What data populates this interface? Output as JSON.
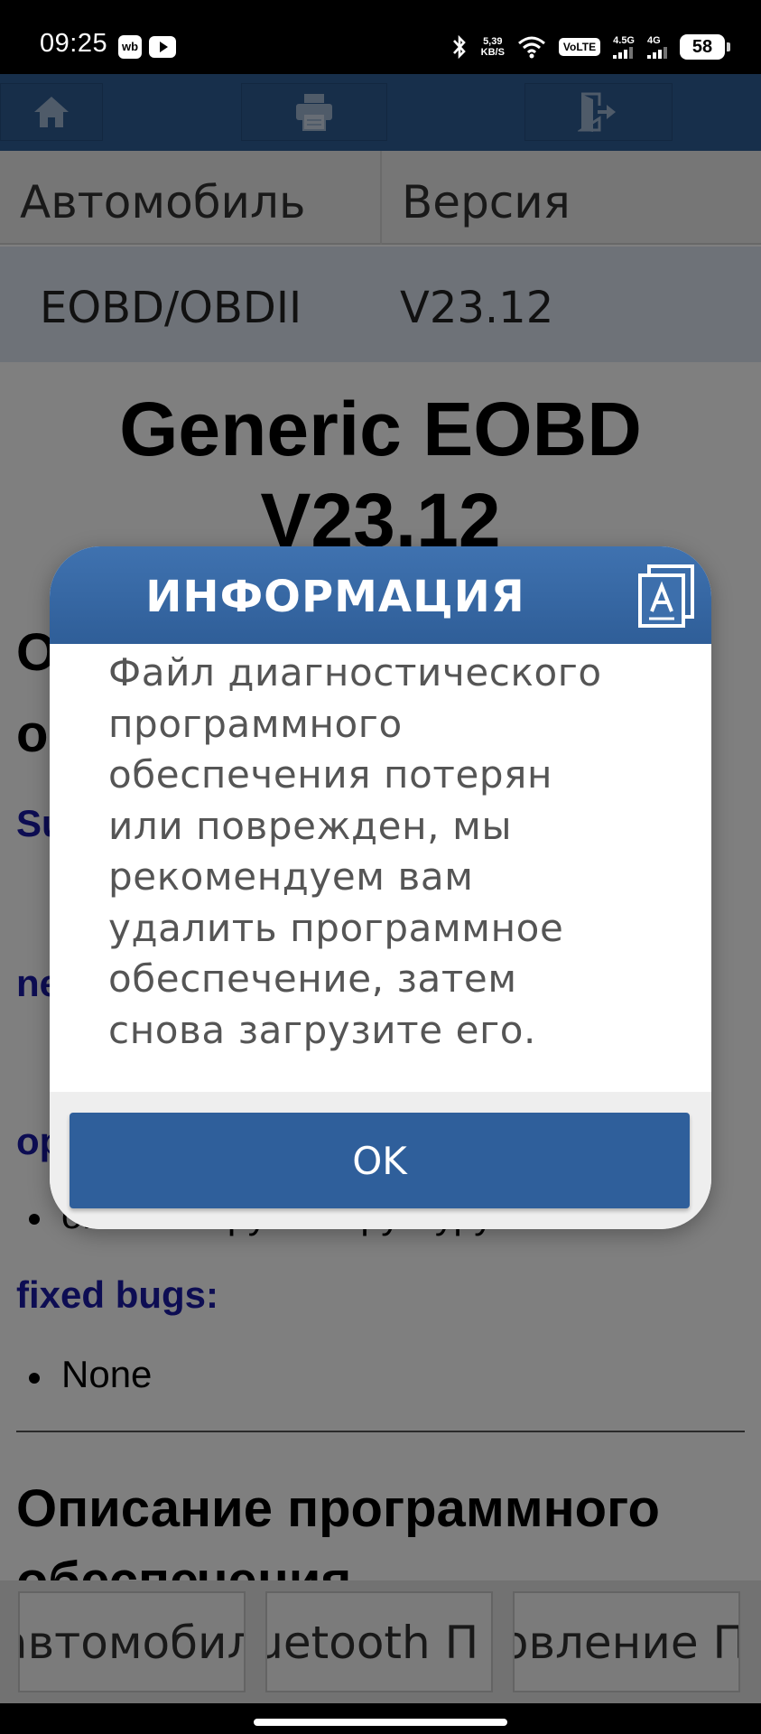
{
  "status_bar": {
    "time": "09:25",
    "app_badge": "wb",
    "net_speed_value": "5,39",
    "net_speed_unit": "KB/S",
    "volte": "VoLTE",
    "sim1_label": "4.5G",
    "sim2_label": "4G",
    "battery": "58"
  },
  "toolbar": {
    "home_icon": "home-icon",
    "print_icon": "printer-icon",
    "exit_icon": "exit-door-icon"
  },
  "info_table": {
    "col1_header": "Автомобиль",
    "col2_header": "Версия",
    "col1_value": "EOBD/OBDII",
    "col2_value": "V23.12"
  },
  "document": {
    "title_line1": "Generic EOBD",
    "title_line2": "V23.12",
    "section_o1": "О",
    "section_o2": "о",
    "label_su": "Su",
    "label_ne": "ne",
    "label_op": "op",
    "partial_bullet": "оптимизируем структуру ПО",
    "fixed_bugs_label": "fixed bugs:",
    "fixed_bugs_item": "None",
    "section2_line1": "Описание программного",
    "section2_line2": "обеспечения"
  },
  "bottom_tabs": [
    {
      "label": "автомобиль"
    },
    {
      "label": "Bluetooth П"
    },
    {
      "label": "Обновление П"
    }
  ],
  "dialog": {
    "title": "ИНФОРМАЦИЯ",
    "header_icon": "document-a-icon",
    "message_lines": [
      "Файл диагностического",
      "программного",
      "обеспечения потерян",
      "или поврежден, мы",
      "рекомендуем вам",
      "удалить программное",
      "обеспечение, затем",
      "снова загрузите его."
    ],
    "ok_label": "OK"
  },
  "colors": {
    "toolbar": "#2f5f96",
    "dialog_header": "#3b6ba8",
    "ok_button": "#2f5f9b",
    "link_label": "#1a1aa6"
  }
}
